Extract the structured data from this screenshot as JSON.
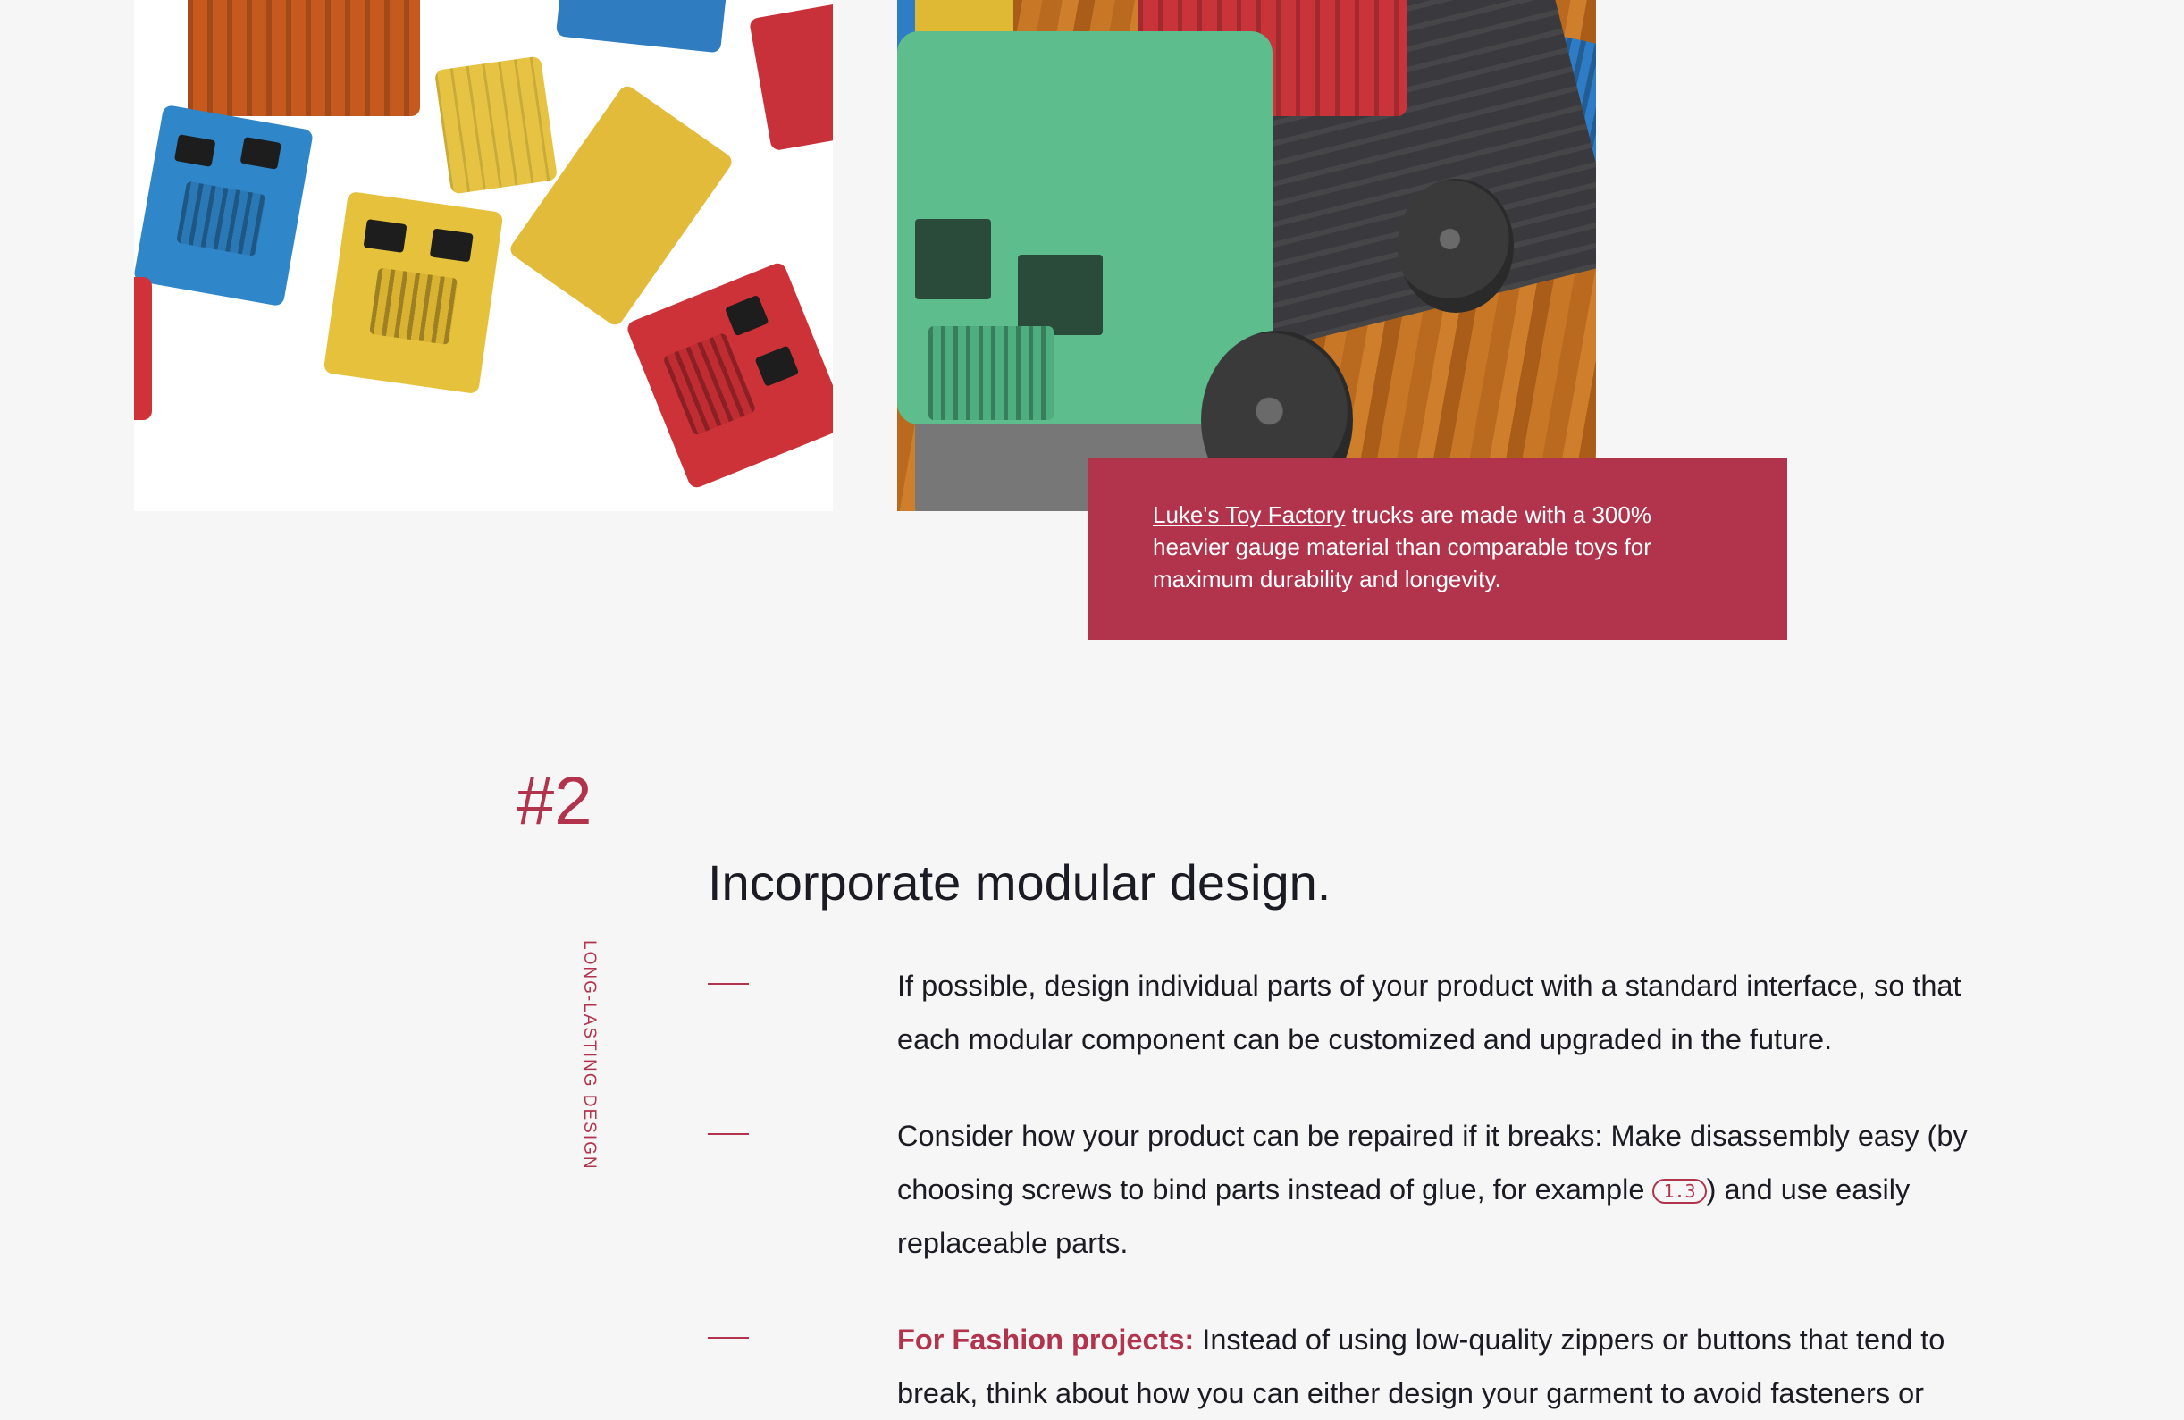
{
  "caption": {
    "link_text": "Luke's Toy Factory",
    "text": " trucks are made with a 300% heavier gauge material than comparable toys for maximum durability and longevity."
  },
  "section": {
    "number": "#2",
    "tag": "LONG-LASTING DESIGN",
    "title": "Incorporate modular design."
  },
  "points": [
    {
      "text": "If possible, design individual parts of your product with a standard interface, so that each modular component can be customized and upgraded in the future."
    },
    {
      "text_before": "Consider how your product can be repaired if it breaks: Make disassembly easy (by choosing screws to bind parts instead of glue, for example ",
      "ref": "1.3",
      "text_after": ") and use easily replaceable parts."
    },
    {
      "emphasis": "For Fashion projects:",
      "text": " Instead of using low-quality zippers or buttons that tend to break, think about how you can either design your garment to avoid fasteners or"
    }
  ],
  "colors": {
    "accent": "#b1334c",
    "background": "#f6f6f6",
    "text": "#1b1b24"
  }
}
